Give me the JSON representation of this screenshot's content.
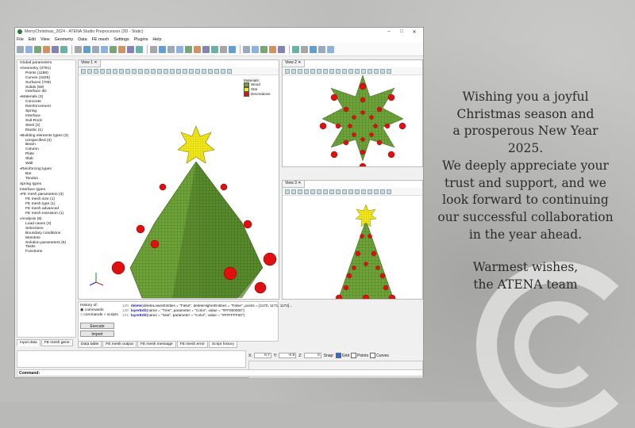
{
  "window": {
    "title": "MerryChristmas_2024 - ATENA Studio Preprocessor (3D - Static)",
    "controls": [
      "–",
      "□",
      "✕"
    ]
  },
  "menu": [
    "File",
    "Edit",
    "View",
    "Geometry",
    "Data",
    "FE mesh",
    "Settings",
    "Plugins",
    "Help"
  ],
  "tree": [
    {
      "level": 0,
      "leaf": true,
      "label": "Global parameters"
    },
    {
      "level": 0,
      "label": "Geometry (3781)"
    },
    {
      "level": 1,
      "label": "Points (1188)"
    },
    {
      "level": 1,
      "label": "Curves (1625)"
    },
    {
      "level": 1,
      "label": "Surfaces (709)"
    },
    {
      "level": 1,
      "label": "Solids (59)"
    },
    {
      "level": 1,
      "label": "Interface 3D"
    },
    {
      "level": 0,
      "label": "Materials (3)"
    },
    {
      "level": 1,
      "label": "Concrete"
    },
    {
      "level": 1,
      "label": "Reinforcement"
    },
    {
      "level": 1,
      "label": "Spring"
    },
    {
      "level": 1,
      "label": "Interface"
    },
    {
      "level": 1,
      "label": "Soil-Rock"
    },
    {
      "level": 1,
      "label": "Steel (2)"
    },
    {
      "level": 1,
      "label": "Elastic (1)"
    },
    {
      "level": 0,
      "label": "Building elements types (3)"
    },
    {
      "level": 1,
      "label": "Unspecified (3)"
    },
    {
      "level": 1,
      "label": "Beam"
    },
    {
      "level": 1,
      "label": "Column"
    },
    {
      "level": 1,
      "label": "Plate"
    },
    {
      "level": 1,
      "label": "Slab"
    },
    {
      "level": 1,
      "label": "Wall"
    },
    {
      "level": 0,
      "label": "Reinforcing types"
    },
    {
      "level": 1,
      "label": "Bar"
    },
    {
      "level": 1,
      "label": "Tendon"
    },
    {
      "level": 0,
      "leaf": true,
      "label": "Spring types"
    },
    {
      "level": 0,
      "leaf": true,
      "label": "Interface types"
    },
    {
      "level": 0,
      "label": "FE mesh parameters (3)"
    },
    {
      "level": 1,
      "label": "FE mesh size (1)"
    },
    {
      "level": 1,
      "label": "FE mesh type (1)"
    },
    {
      "level": 1,
      "label": "FE mesh advanced"
    },
    {
      "level": 1,
      "label": "FE mesh extrusion (1)"
    },
    {
      "level": 0,
      "label": "Analysis (9)"
    },
    {
      "level": 1,
      "label": "Load cases (3)"
    },
    {
      "level": 1,
      "label": "Selections"
    },
    {
      "level": 1,
      "label": "Boundary conditions"
    },
    {
      "level": 1,
      "label": "Monitors"
    },
    {
      "level": 1,
      "label": "Solution parameters (6)"
    },
    {
      "level": 1,
      "label": "Tasks"
    },
    {
      "level": 1,
      "label": "Functions"
    }
  ],
  "sidebar_tabs": [
    "Input data",
    "FE mesh gene"
  ],
  "views": {
    "v1": "View 1",
    "v2": "View 2",
    "v3": "View 3"
  },
  "legend": {
    "title": "Materials:",
    "items": [
      {
        "label": "Wood",
        "color": "#6ea33a"
      },
      {
        "label": "Star",
        "color": "#f2e81c"
      },
      {
        "label": "Decorations",
        "color": "#e01010"
      }
    ]
  },
  "history": {
    "label": "History of:",
    "opt1": "commands",
    "opt2": "commands + scripts",
    "execute": "Execute",
    "import": "Import",
    "lines": [
      {
        "n": "120",
        "fn": "delete",
        "rest": "(deleteLowerEntities = \"False\", deleteHigherEntities = \"False\", points = [1170, 1171, 1172]..."
      },
      {
        "n": "130",
        "fn": "layerEdit",
        "rest": "(name = \"Tree\", parameter = \"Color\", value = \"#FF000000\")"
      },
      {
        "n": "131",
        "fn": "layerEdit",
        "rest": "(name = \"Star\", parameter = \"Color\", value = \"#FFFFFF00\")"
      }
    ]
  },
  "bottom_tabs": [
    "Data table",
    "FE mesh output",
    "FE mesh message",
    "FE mesh error",
    "Script history"
  ],
  "coords": {
    "x_label": "X:",
    "x": "0.7",
    "y_label": "Y:",
    "y": "-0.9",
    "z_label": "Z:",
    "z": "0",
    "snap": "Snap:",
    "grid": "Grid",
    "points": "Points",
    "curves": "Curves"
  },
  "command_label": "Command:",
  "greeting": {
    "line1": "Wishing you a joyful",
    "line2": "Christmas season and",
    "line3": "a prosperous New Year",
    "line4": "2025.",
    "line5": "We deeply appreciate your",
    "line6": "trust and support, and we",
    "line7": "look forward to continuing",
    "line8": "our successful collaboration",
    "line9": "in the year ahead.",
    "sign1": "Warmest wishes,",
    "sign2": "the ATENA team"
  },
  "colors": {
    "wood": "#6ea33a",
    "star": "#f2e81c",
    "ornament": "#e01010"
  }
}
